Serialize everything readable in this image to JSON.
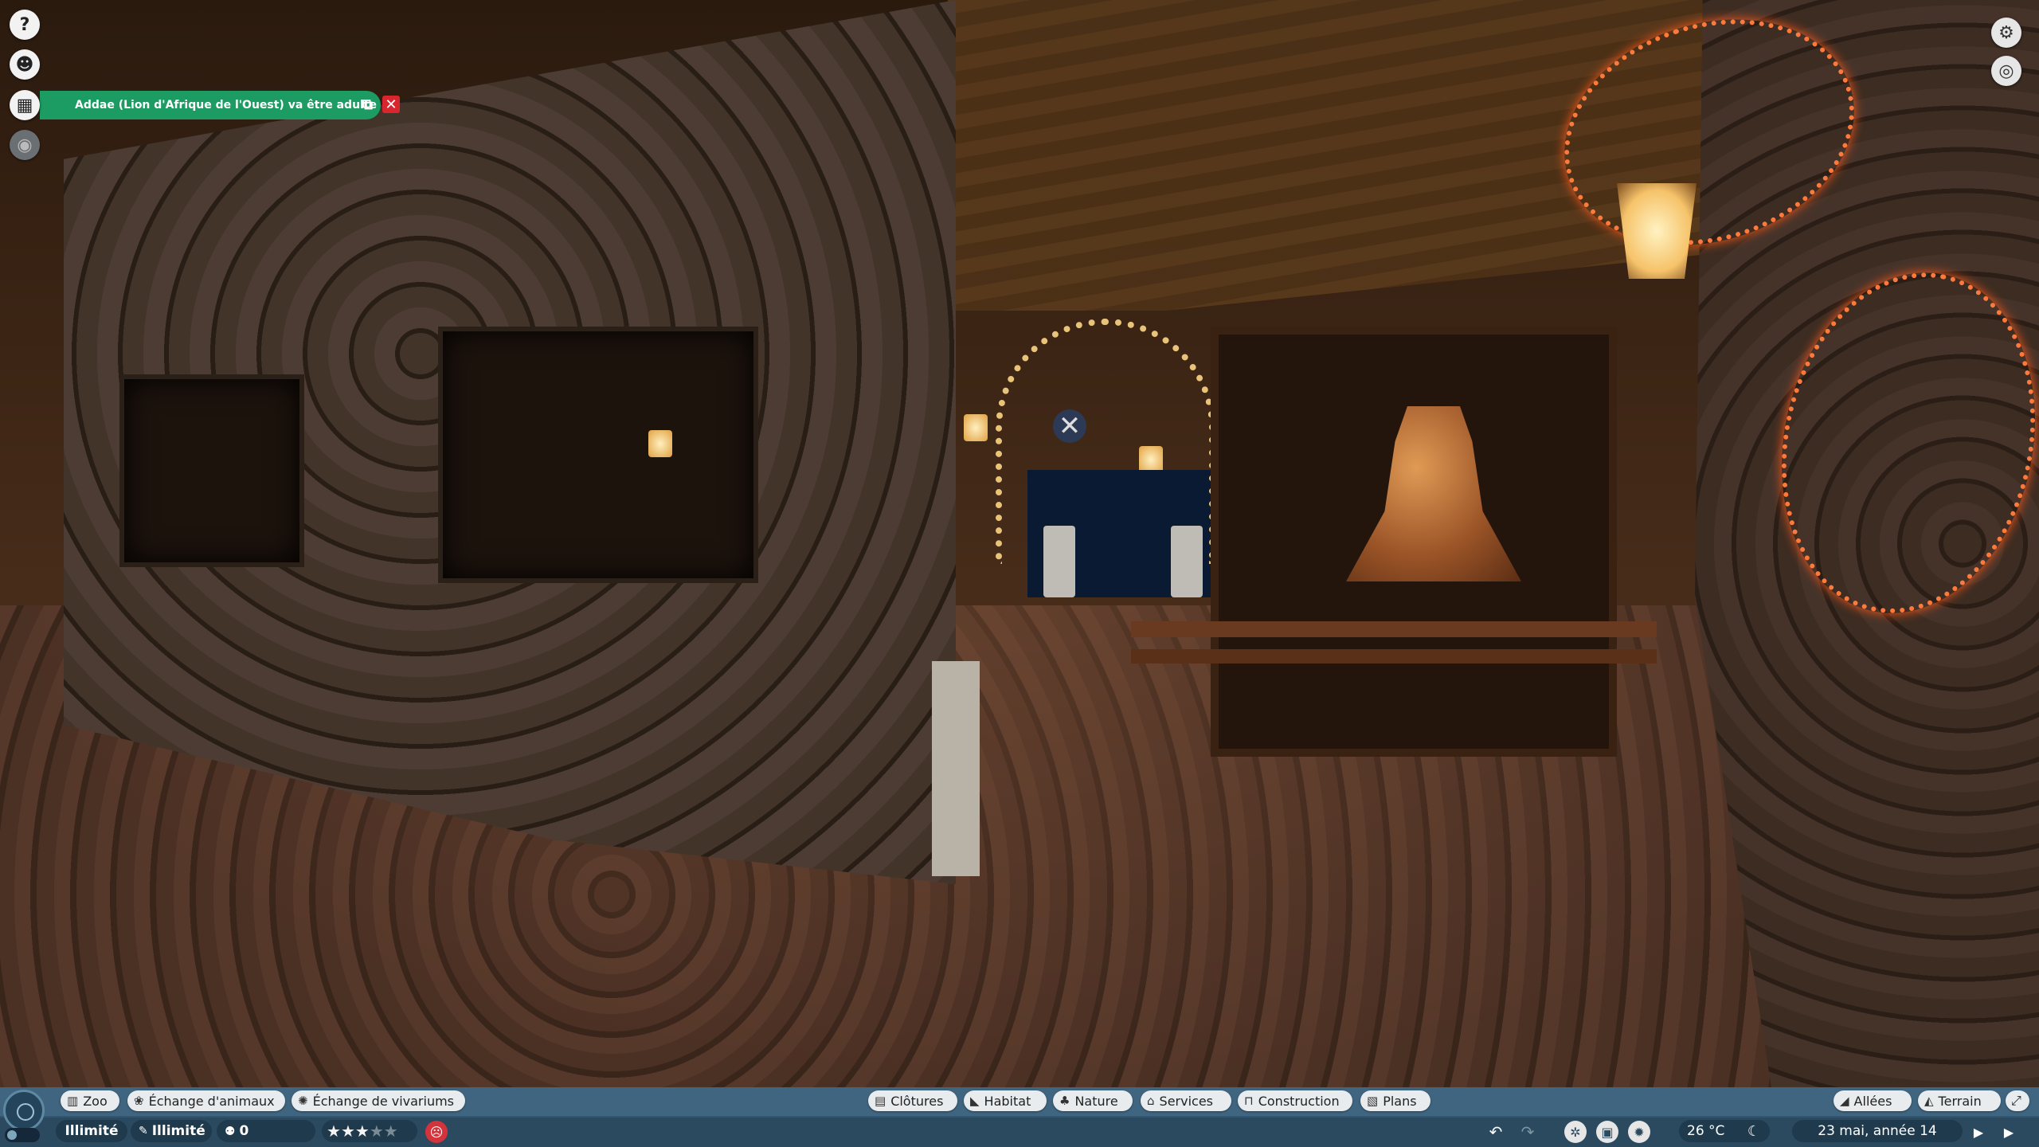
{
  "notification": {
    "text": "Addae (Lion d'Afrique de l'Ouest) va être adulte",
    "open_icon": "external-link-icon",
    "close_symbol": "✕"
  },
  "left_rail": [
    {
      "name": "help-button",
      "icon": "question-icon",
      "glyph": "?"
    },
    {
      "name": "zookeeper-button",
      "icon": "keeper-icon",
      "glyph": "☻"
    },
    {
      "name": "calendar-button",
      "icon": "calendar-icon",
      "glyph": "▦"
    },
    {
      "name": "view-button",
      "icon": "eye-icon",
      "glyph": "◉"
    }
  ],
  "right_rail": [
    {
      "name": "settings-button",
      "icon": "gear-icon",
      "glyph": "⚙"
    },
    {
      "name": "camera-view-button",
      "icon": "eye-icon",
      "glyph": "◎"
    }
  ],
  "bottom": {
    "left_tabs": [
      {
        "label": "Zoo",
        "icon": "zoo-icon",
        "glyph": "▥"
      },
      {
        "label": "Échange d'animaux",
        "icon": "paw-icon",
        "glyph": "❀"
      },
      {
        "label": "Échange de vivariums",
        "icon": "vivarium-icon",
        "glyph": "✺"
      }
    ],
    "build_tabs": [
      {
        "label": "Clôtures",
        "icon": "fence-icon",
        "glyph": "▤"
      },
      {
        "label": "Habitat",
        "icon": "habitat-icon",
        "glyph": "◣"
      },
      {
        "label": "Nature",
        "icon": "tree-icon",
        "glyph": "♣"
      },
      {
        "label": "Services",
        "icon": "shop-icon",
        "glyph": "⌂"
      },
      {
        "label": "Construction",
        "icon": "building-icon",
        "glyph": "⊓"
      },
      {
        "label": "Plans",
        "icon": "blueprint-icon",
        "glyph": "▧"
      }
    ],
    "right_tabs": [
      {
        "label": "Allées",
        "icon": "path-icon",
        "glyph": "◢"
      },
      {
        "label": "Terrain",
        "icon": "terrain-icon",
        "glyph": "◭"
      }
    ],
    "expand_glyph": "⤢",
    "money": "Illimité",
    "research": "Illimité",
    "research_glyph": "✎",
    "guests": "0",
    "guests_glyph": "⚉",
    "rating_stars": 3,
    "rating_max": 5,
    "mood_glyph": "☹",
    "undo_glyph": "↶",
    "redo_glyph": "↷",
    "overlay_icons": [
      "✲",
      "▣",
      "✹"
    ],
    "temperature": "26 °C",
    "moon_glyph": "☾",
    "date": "23 mai, année 14",
    "play_glyph": "▶",
    "fast_glyph": "▶"
  },
  "colors": {
    "notification_bg": "#1c9b62",
    "close_bg": "#d9262e",
    "bar_bg": "#2b4a60",
    "mood_bad": "#d5333b"
  }
}
